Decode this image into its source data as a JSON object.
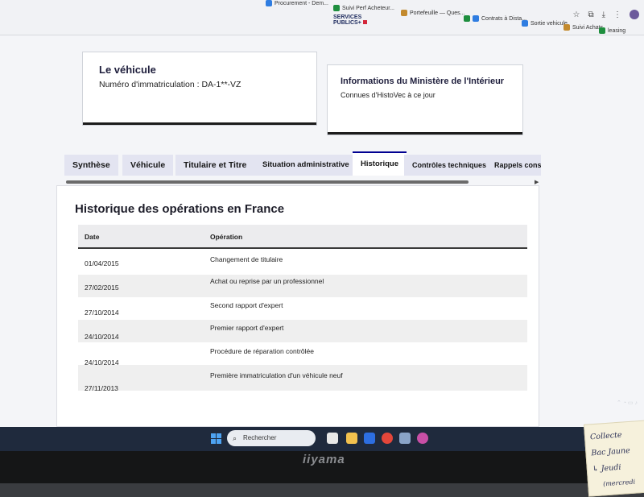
{
  "bookmarks": [
    {
      "label": "Procurement - Dem..."
    },
    {
      "label": "Suivi Perf Acheteur..."
    },
    {
      "label": "Portefeuille — Ques..."
    },
    {
      "label": "Contrats à Dista..."
    },
    {
      "label": "Sortie vehicule"
    },
    {
      "label": "Suivi Achats"
    },
    {
      "label": "leasing"
    }
  ],
  "brand": {
    "line1": "SERVICES",
    "line2": "PUBLICS+"
  },
  "vehicle_card": {
    "title": "Le véhicule",
    "registration": "Numéro d'immatriculation : DA-1**-VZ"
  },
  "ministry_card": {
    "title": "Informations du Ministère de l'Intérieur",
    "text": "Connues d'HistoVec à ce jour"
  },
  "tabs": [
    {
      "label": "Synthèse",
      "active": false
    },
    {
      "label": "Véhicule",
      "active": false
    },
    {
      "label": "Titulaire et Titre",
      "active": false
    },
    {
      "label": "Situation administrative",
      "active": false
    },
    {
      "label": "Historique",
      "active": true
    },
    {
      "label": "Contrôles techniques",
      "active": false
    },
    {
      "label": "Rappels constru",
      "active": false
    }
  ],
  "history": {
    "title": "Historique des opérations en France",
    "columns": {
      "date": "Date",
      "operation": "Opération"
    },
    "rows": [
      {
        "date": "01/04/2015",
        "operation": "Changement de titulaire"
      },
      {
        "date": "27/02/2015",
        "operation": "Achat ou reprise par un professionnel"
      },
      {
        "date": "27/10/2014",
        "operation": "Second rapport d'expert"
      },
      {
        "date": "24/10/2014",
        "operation": "Premier rapport d'expert"
      },
      {
        "date": "24/10/2014",
        "operation": "Procédure de réparation contrôlée"
      },
      {
        "date": "27/11/2013",
        "operation": "Première immatriculation d'un véhicule neuf"
      }
    ]
  },
  "taskbar": {
    "search_placeholder": "Rechercher"
  },
  "monitor_brand": "iiyama",
  "sticky_note": {
    "line1": "Collecte",
    "line2": "Bac Jaune",
    "line3": "↳ Jeudi",
    "line4": "(mercredi"
  },
  "colors": {
    "accent": "#000091",
    "tab_bg": "#e3e4f1",
    "taskbar": "#1f2a3d"
  }
}
